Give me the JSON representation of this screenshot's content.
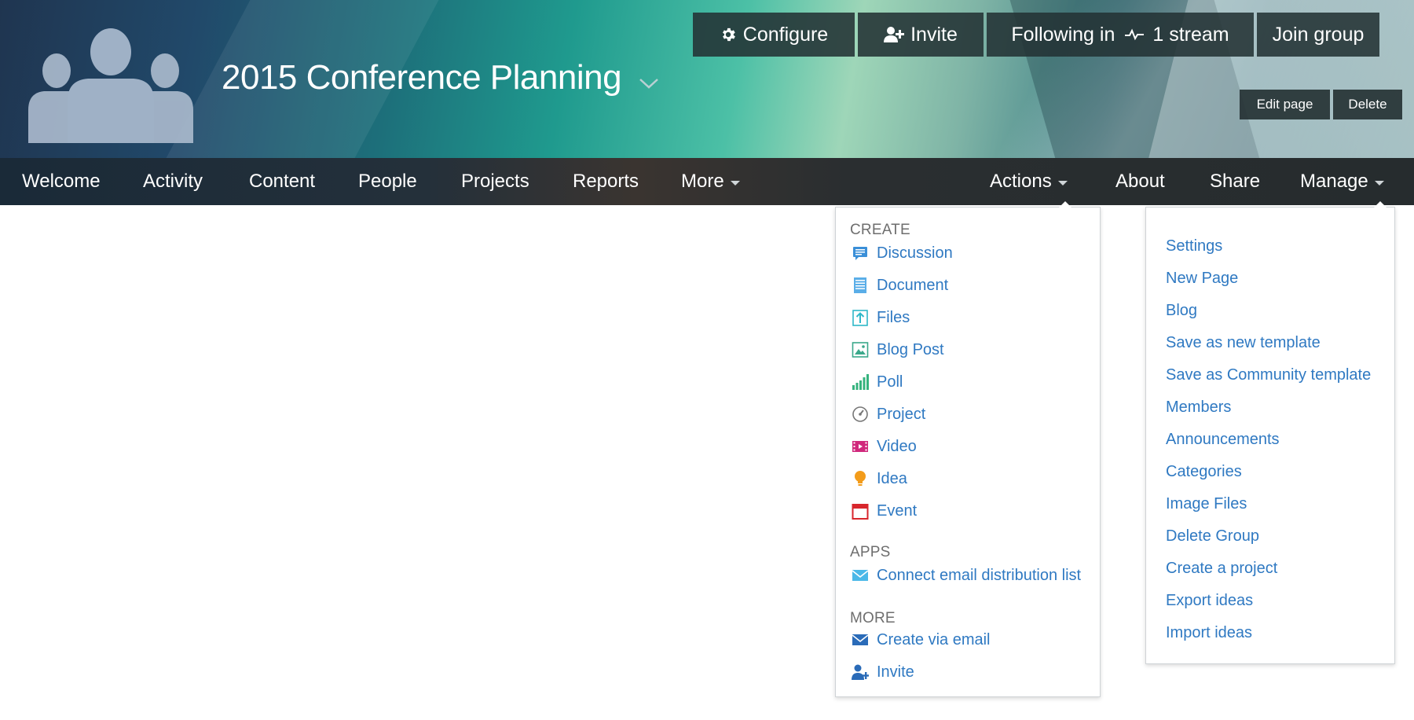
{
  "group": {
    "title": "2015 Conference Planning",
    "avatar_icon": "group-people-icon",
    "title_chevron_icon": "chevron-down-icon"
  },
  "top_buttons": {
    "configure": "Configure",
    "invite": "Invite",
    "following_prefix": "Following in",
    "following_count": "1 stream",
    "join": "Join group"
  },
  "page_buttons": {
    "edit": "Edit page",
    "delete": "Delete"
  },
  "nav": {
    "left": [
      "Welcome",
      "Activity",
      "Content",
      "People",
      "Projects",
      "Reports",
      "More"
    ],
    "right": [
      "Actions",
      "About",
      "Share",
      "Manage"
    ]
  },
  "actions_menu": {
    "create_header": "CREATE",
    "create_items": [
      {
        "label": "Discussion",
        "icon": "discussion-icon"
      },
      {
        "label": "Document",
        "icon": "document-icon"
      },
      {
        "label": "Files",
        "icon": "upload-file-icon"
      },
      {
        "label": "Blog Post",
        "icon": "blog-post-icon"
      },
      {
        "label": "Poll",
        "icon": "poll-icon"
      },
      {
        "label": "Project",
        "icon": "project-icon"
      },
      {
        "label": "Video",
        "icon": "video-icon"
      },
      {
        "label": "Idea",
        "icon": "idea-icon"
      },
      {
        "label": "Event",
        "icon": "event-icon"
      }
    ],
    "apps_header": "APPS",
    "apps_items": [
      {
        "label": "Connect email distribution list",
        "icon": "email-icon"
      }
    ],
    "more_header": "MORE",
    "more_items": [
      {
        "label": "Create via email",
        "icon": "mail-icon"
      },
      {
        "label": "Invite",
        "icon": "invite-user-icon"
      }
    ]
  },
  "manage_menu": {
    "items": [
      "Settings",
      "New Page",
      "Blog",
      "Save as new template",
      "Save as Community template",
      "Members",
      "Announcements",
      "Categories",
      "Image Files",
      "Delete Group",
      "Create a project",
      "Export ideas",
      "Import ideas"
    ]
  },
  "colors": {
    "link": "#2f79c2",
    "nav_text": "#ffffff",
    "section_header": "#6e6e6e"
  }
}
